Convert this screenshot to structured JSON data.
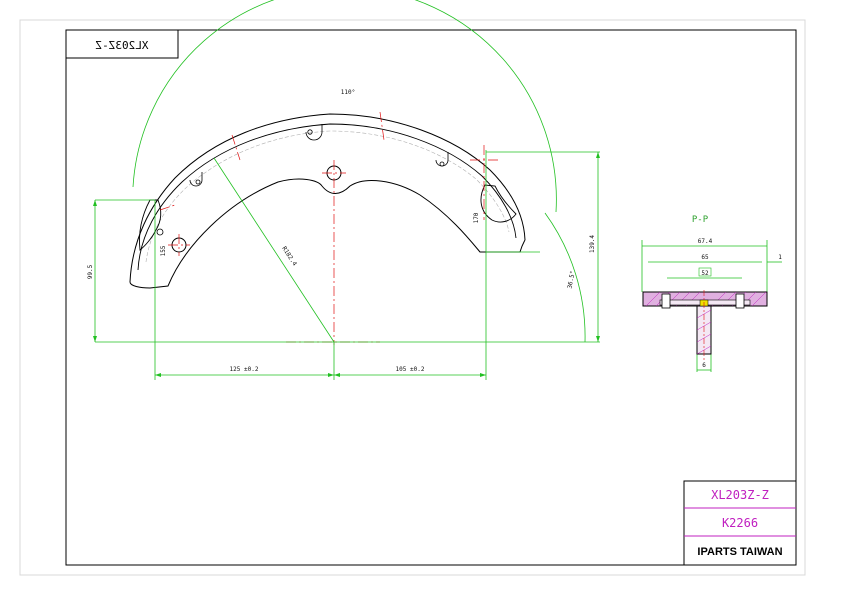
{
  "drawing": {
    "mirror_label": "XL203Z-Z",
    "arc_angle": "110°",
    "radius": "R182.4",
    "offset_left": "125",
    "offset_left_tol": "0.2",
    "offset_right": "105",
    "offset_right_tol": "0.2",
    "height_left": "99.5",
    "height_right": "139.4",
    "inner_left": "155",
    "inner_right": "170",
    "angle_right": "36.5°",
    "section_label": "P-P",
    "section_width": "67.4",
    "section_width2": "65",
    "section_inner": "52",
    "section_lip": "1",
    "section_web": "6"
  },
  "title_block": {
    "part_number": "XL203Z-Z",
    "ref_number": "K2266",
    "company": "IPARTS TAIWAN"
  },
  "colors": {
    "outline": "#000000",
    "dimension": "#22c022",
    "center": "#e01010",
    "magenta": "#c020c0",
    "hatch": "#e0b0e0"
  }
}
